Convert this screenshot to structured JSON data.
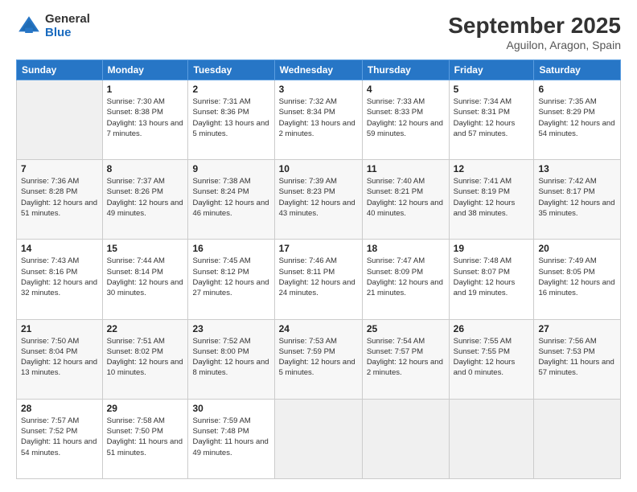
{
  "logo": {
    "general": "General",
    "blue": "Blue"
  },
  "title": "September 2025",
  "location": "Aguilon, Aragon, Spain",
  "header_days": [
    "Sunday",
    "Monday",
    "Tuesday",
    "Wednesday",
    "Thursday",
    "Friday",
    "Saturday"
  ],
  "weeks": [
    [
      {
        "day": null
      },
      {
        "day": "1",
        "sunrise": "Sunrise: 7:30 AM",
        "sunset": "Sunset: 8:38 PM",
        "daylight": "Daylight: 13 hours and 7 minutes."
      },
      {
        "day": "2",
        "sunrise": "Sunrise: 7:31 AM",
        "sunset": "Sunset: 8:36 PM",
        "daylight": "Daylight: 13 hours and 5 minutes."
      },
      {
        "day": "3",
        "sunrise": "Sunrise: 7:32 AM",
        "sunset": "Sunset: 8:34 PM",
        "daylight": "Daylight: 13 hours and 2 minutes."
      },
      {
        "day": "4",
        "sunrise": "Sunrise: 7:33 AM",
        "sunset": "Sunset: 8:33 PM",
        "daylight": "Daylight: 12 hours and 59 minutes."
      },
      {
        "day": "5",
        "sunrise": "Sunrise: 7:34 AM",
        "sunset": "Sunset: 8:31 PM",
        "daylight": "Daylight: 12 hours and 57 minutes."
      },
      {
        "day": "6",
        "sunrise": "Sunrise: 7:35 AM",
        "sunset": "Sunset: 8:29 PM",
        "daylight": "Daylight: 12 hours and 54 minutes."
      }
    ],
    [
      {
        "day": "7",
        "sunrise": "Sunrise: 7:36 AM",
        "sunset": "Sunset: 8:28 PM",
        "daylight": "Daylight: 12 hours and 51 minutes."
      },
      {
        "day": "8",
        "sunrise": "Sunrise: 7:37 AM",
        "sunset": "Sunset: 8:26 PM",
        "daylight": "Daylight: 12 hours and 49 minutes."
      },
      {
        "day": "9",
        "sunrise": "Sunrise: 7:38 AM",
        "sunset": "Sunset: 8:24 PM",
        "daylight": "Daylight: 12 hours and 46 minutes."
      },
      {
        "day": "10",
        "sunrise": "Sunrise: 7:39 AM",
        "sunset": "Sunset: 8:23 PM",
        "daylight": "Daylight: 12 hours and 43 minutes."
      },
      {
        "day": "11",
        "sunrise": "Sunrise: 7:40 AM",
        "sunset": "Sunset: 8:21 PM",
        "daylight": "Daylight: 12 hours and 40 minutes."
      },
      {
        "day": "12",
        "sunrise": "Sunrise: 7:41 AM",
        "sunset": "Sunset: 8:19 PM",
        "daylight": "Daylight: 12 hours and 38 minutes."
      },
      {
        "day": "13",
        "sunrise": "Sunrise: 7:42 AM",
        "sunset": "Sunset: 8:17 PM",
        "daylight": "Daylight: 12 hours and 35 minutes."
      }
    ],
    [
      {
        "day": "14",
        "sunrise": "Sunrise: 7:43 AM",
        "sunset": "Sunset: 8:16 PM",
        "daylight": "Daylight: 12 hours and 32 minutes."
      },
      {
        "day": "15",
        "sunrise": "Sunrise: 7:44 AM",
        "sunset": "Sunset: 8:14 PM",
        "daylight": "Daylight: 12 hours and 30 minutes."
      },
      {
        "day": "16",
        "sunrise": "Sunrise: 7:45 AM",
        "sunset": "Sunset: 8:12 PM",
        "daylight": "Daylight: 12 hours and 27 minutes."
      },
      {
        "day": "17",
        "sunrise": "Sunrise: 7:46 AM",
        "sunset": "Sunset: 8:11 PM",
        "daylight": "Daylight: 12 hours and 24 minutes."
      },
      {
        "day": "18",
        "sunrise": "Sunrise: 7:47 AM",
        "sunset": "Sunset: 8:09 PM",
        "daylight": "Daylight: 12 hours and 21 minutes."
      },
      {
        "day": "19",
        "sunrise": "Sunrise: 7:48 AM",
        "sunset": "Sunset: 8:07 PM",
        "daylight": "Daylight: 12 hours and 19 minutes."
      },
      {
        "day": "20",
        "sunrise": "Sunrise: 7:49 AM",
        "sunset": "Sunset: 8:05 PM",
        "daylight": "Daylight: 12 hours and 16 minutes."
      }
    ],
    [
      {
        "day": "21",
        "sunrise": "Sunrise: 7:50 AM",
        "sunset": "Sunset: 8:04 PM",
        "daylight": "Daylight: 12 hours and 13 minutes."
      },
      {
        "day": "22",
        "sunrise": "Sunrise: 7:51 AM",
        "sunset": "Sunset: 8:02 PM",
        "daylight": "Daylight: 12 hours and 10 minutes."
      },
      {
        "day": "23",
        "sunrise": "Sunrise: 7:52 AM",
        "sunset": "Sunset: 8:00 PM",
        "daylight": "Daylight: 12 hours and 8 minutes."
      },
      {
        "day": "24",
        "sunrise": "Sunrise: 7:53 AM",
        "sunset": "Sunset: 7:59 PM",
        "daylight": "Daylight: 12 hours and 5 minutes."
      },
      {
        "day": "25",
        "sunrise": "Sunrise: 7:54 AM",
        "sunset": "Sunset: 7:57 PM",
        "daylight": "Daylight: 12 hours and 2 minutes."
      },
      {
        "day": "26",
        "sunrise": "Sunrise: 7:55 AM",
        "sunset": "Sunset: 7:55 PM",
        "daylight": "Daylight: 12 hours and 0 minutes."
      },
      {
        "day": "27",
        "sunrise": "Sunrise: 7:56 AM",
        "sunset": "Sunset: 7:53 PM",
        "daylight": "Daylight: 11 hours and 57 minutes."
      }
    ],
    [
      {
        "day": "28",
        "sunrise": "Sunrise: 7:57 AM",
        "sunset": "Sunset: 7:52 PM",
        "daylight": "Daylight: 11 hours and 54 minutes."
      },
      {
        "day": "29",
        "sunrise": "Sunrise: 7:58 AM",
        "sunset": "Sunset: 7:50 PM",
        "daylight": "Daylight: 11 hours and 51 minutes."
      },
      {
        "day": "30",
        "sunrise": "Sunrise: 7:59 AM",
        "sunset": "Sunset: 7:48 PM",
        "daylight": "Daylight: 11 hours and 49 minutes."
      },
      {
        "day": null
      },
      {
        "day": null
      },
      {
        "day": null
      },
      {
        "day": null
      }
    ]
  ]
}
